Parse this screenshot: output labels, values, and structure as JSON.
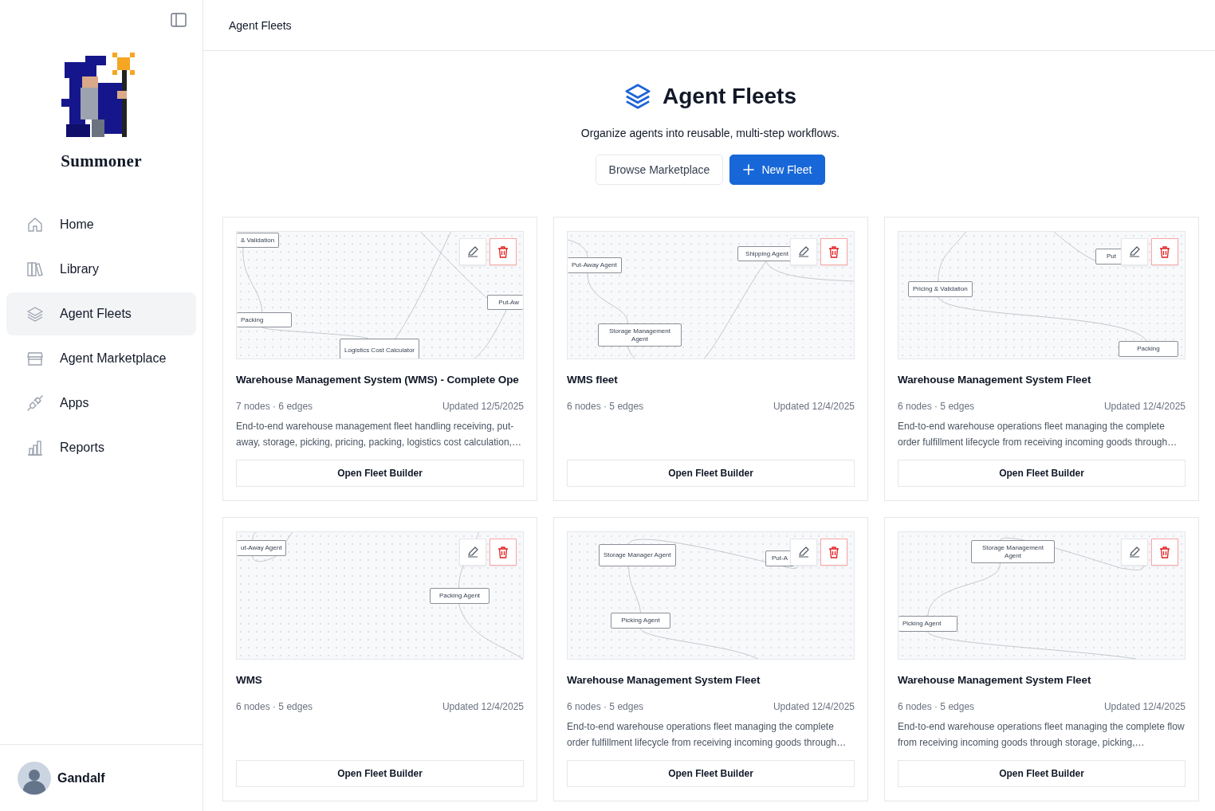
{
  "sidebar": {
    "app_name": "Summoner",
    "nav": [
      {
        "label": "Home",
        "kind": "home",
        "selected": false
      },
      {
        "label": "Library",
        "kind": "library",
        "selected": false
      },
      {
        "label": "Agent Fleets",
        "kind": "layers",
        "selected": true
      },
      {
        "label": "Agent Marketplace",
        "kind": "store",
        "selected": false
      },
      {
        "label": "Apps",
        "kind": "plug",
        "selected": false
      },
      {
        "label": "Reports",
        "kind": "chart",
        "selected": false
      }
    ],
    "user": {
      "name": "Gandalf"
    }
  },
  "header": {
    "breadcrumb": "Agent Fleets"
  },
  "hero": {
    "title": "Agent Fleets",
    "subtitle": "Organize agents into reusable, multi-step workflows.",
    "buttons": [
      {
        "label": "Browse Marketplace",
        "kind": "secondary"
      },
      {
        "label": "New Fleet",
        "kind": "primary"
      }
    ]
  },
  "fleets": [
    {
      "title": "Warehouse Management System (WMS) - Complete Ope",
      "stats": "7 nodes · 6 edges",
      "updated": "Updated 12/5/2025",
      "description": "End-to-end warehouse management fleet handling receiving, put-away, storage, picking, pricing, packing, logistics cost calculation,…",
      "nodes": [
        "& Validation",
        "Packing",
        "Logistics Cost Calculator",
        "Put-Aw"
      ],
      "button": "Open Fleet Builder"
    },
    {
      "title": "WMS fleet",
      "stats": "6 nodes · 5 edges",
      "updated": "Updated 12/4/2025",
      "nodes": [
        "Put-Away Agent",
        "Shipping Agent",
        "Storage Management Agent"
      ],
      "button": "Open Fleet Builder"
    },
    {
      "title": "Warehouse Management System Fleet",
      "stats": "6 nodes · 5 edges",
      "updated": "Updated 12/4/2025",
      "description": "End-to-end warehouse operations fleet managing the complete order fulfillment lifecycle from receiving incoming goods through…",
      "nodes": [
        "Put",
        "Pricing & Validation",
        "Packing"
      ],
      "button": "Open Fleet Builder"
    },
    {
      "title": "WMS",
      "stats": "6 nodes · 5 edges",
      "updated": "Updated 12/4/2025",
      "nodes": [
        "ut-Away Agent",
        "Packing Agent"
      ],
      "button": "Open Fleet Builder"
    },
    {
      "title": "Warehouse Management System Fleet",
      "stats": "6 nodes · 5 edges",
      "updated": "Updated 12/4/2025",
      "description": "End-to-end warehouse operations fleet managing the complete order fulfillment lifecycle from receiving incoming goods through…",
      "nodes": [
        "Storage Manager Agent",
        "Put-A",
        "Picking Agent"
      ],
      "button": "Open Fleet Builder"
    },
    {
      "title": "Warehouse Management System Fleet",
      "stats": "6 nodes · 5 edges",
      "updated": "Updated 12/4/2025",
      "description": "End-to-end warehouse operations fleet managing the complete flow from receiving incoming goods through storage, picking,…",
      "nodes": [
        "Storage Management Agent",
        "Picking Agent"
      ],
      "button": "Open Fleet Builder"
    }
  ]
}
